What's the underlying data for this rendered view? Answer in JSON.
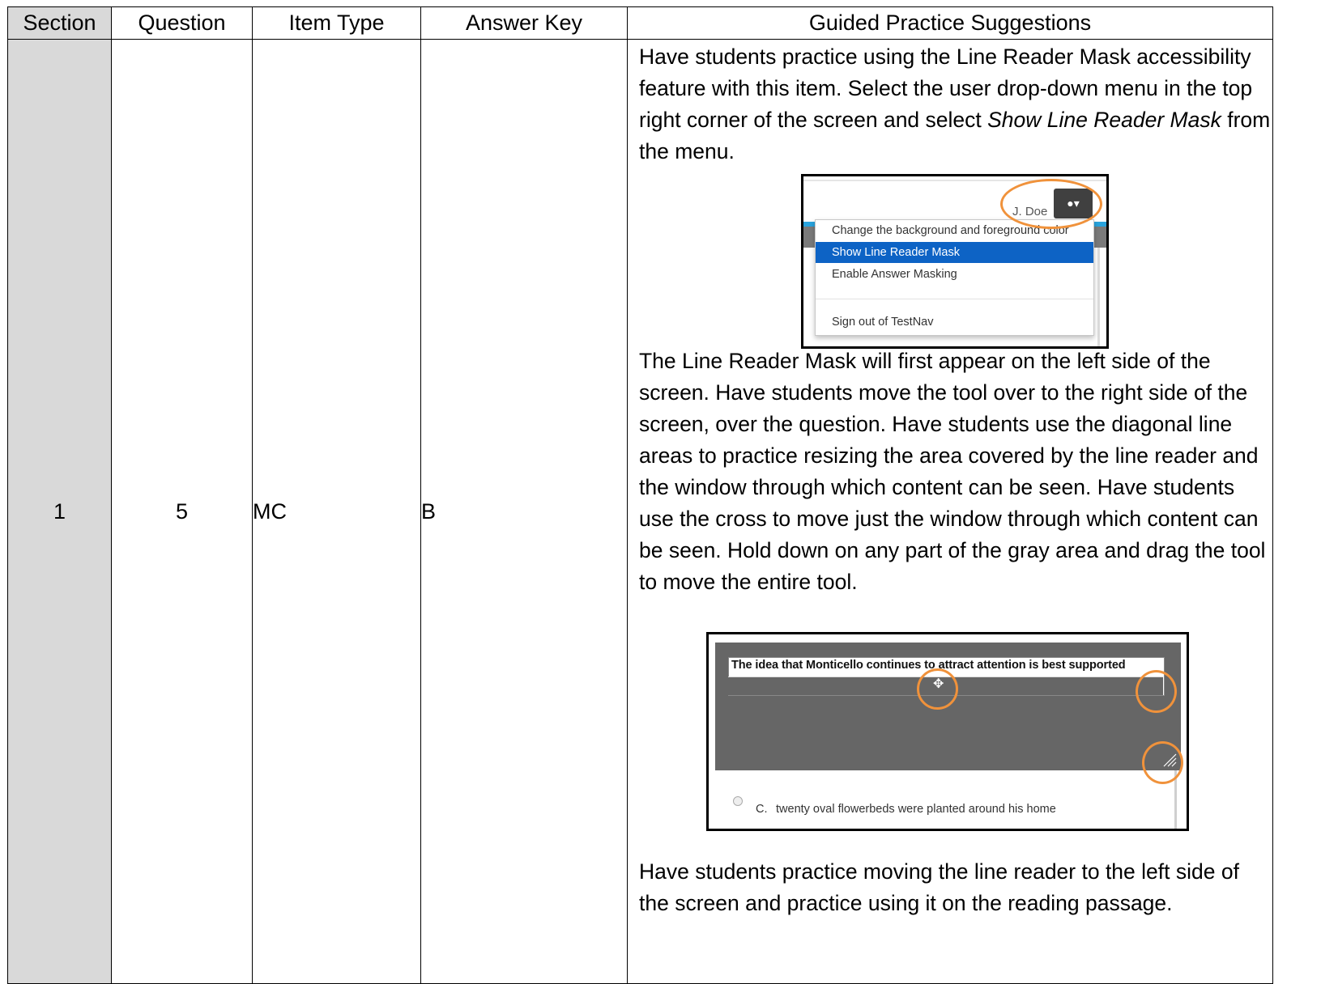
{
  "table": {
    "headers": {
      "section": "Section",
      "question": "Question",
      "item_type": "Item Type",
      "answer_key": "Answer Key",
      "guided": "Guided Practice Suggestions"
    },
    "row": {
      "section": "1",
      "question": "5",
      "item_type": "MC",
      "answer_key": "B"
    }
  },
  "guided": {
    "para1_pre": "Have students practice using the Line Reader Mask accessibility feature with this item. Select the user drop-down menu in the top right corner of the screen and select ",
    "para1_em": "Show Line Reader Mask",
    "para1_post": " from the menu.",
    "para2": "The Line Reader Mask will first appear on the left side of the screen. Have students move the tool over to the right side of the screen, over the question.  Have students use the diagonal line areas to practice resizing the area covered by the line reader and the window through which content can be seen.  Have students use the cross to move just the window through which content can be seen.  Hold down on any part of the gray area and drag the tool to move the entire tool.",
    "para3": "Have students practice moving the line reader to the left side of the screen and practice using it on the reading passage."
  },
  "screenshot1": {
    "username": "J. Doe",
    "user_button_icon": "user-caret-icon",
    "menu_items": [
      "Change the background and foreground color",
      "Show Line Reader Mask",
      "Enable Answer Masking",
      "Sign out of TestNav"
    ],
    "active_item": "Show Line Reader Mask",
    "highlight_color": "#f0923b"
  },
  "screenshot2": {
    "window_text": "The idea that Monticello continues to attract attention is best supported",
    "option_letter": "C.",
    "option_text": "twenty oval flowerbeds were planted around his home",
    "mask_color": "#666666"
  },
  "colors": {
    "shaded_column": "#d9d9d9",
    "menu_active": "#0d63c5",
    "oval": "#f0923b"
  }
}
